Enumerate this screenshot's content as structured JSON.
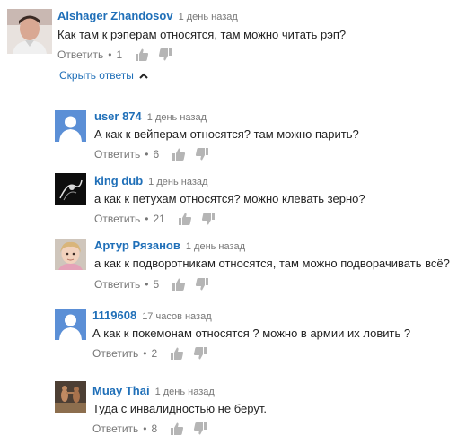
{
  "labels": {
    "reply": "Ответить",
    "dot": "•",
    "toggle_replies": "Скрыть ответы"
  },
  "top_comment": {
    "author": "Alshager Zhandosov",
    "time": "1 день назад",
    "text": "Как там к рэперам относятся, там можно читать рэп?",
    "likes": "1"
  },
  "replies": [
    {
      "author": "user 874",
      "time": "1 день назад",
      "text": "А как к вейперам относятся? там можно парить?",
      "likes": "6"
    },
    {
      "author": "king dub",
      "time": "1 день назад",
      "text": "а как к петухам относятся? можно клевать зерно?",
      "likes": "21"
    },
    {
      "author": "Артур Рязанов",
      "time": "1 день назад",
      "text": "а как к подворотникам относятся, там можно подворачивать всё?",
      "likes": "5"
    },
    {
      "author": "1119608",
      "time": "17 часов назад",
      "text": "А как к покемонам относятся ? можно в армии их ловить ?",
      "likes": "2"
    },
    {
      "author": "Muay Thai",
      "time": "1 день назад",
      "text": "Туда с инвалидностью не берут.",
      "likes": "8"
    }
  ],
  "colors": {
    "link": "#1f6fb8",
    "meta": "#767676",
    "text": "#222222",
    "default_avatar": "#5b8fd6"
  }
}
